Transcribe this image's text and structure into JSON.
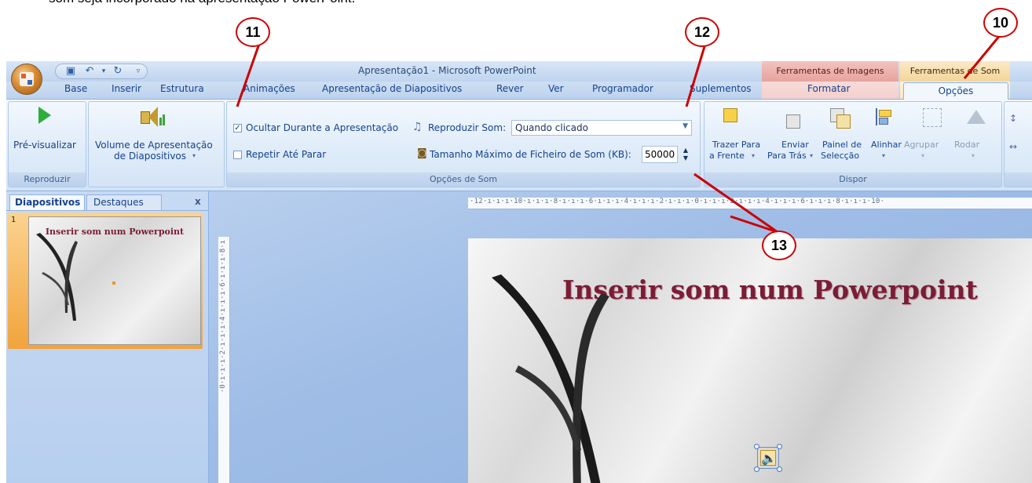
{
  "top_text": "som seja incorporado na apresentação PowerPoint.",
  "window": {
    "title": "Apresentação1 - Microsoft PowerPoint",
    "context_tabs": {
      "imagens": "Ferramentas de Imagens",
      "som": "Ferramentas de Som"
    }
  },
  "qat": {
    "save_icon": "save-icon",
    "undo_icon": "undo-icon",
    "redo_icon": "redo-icon",
    "customize_icon": "customize-icon"
  },
  "tabs": [
    "Base",
    "Inserir",
    "Estrutura",
    "Animações",
    "Apresentação de Diapositivos",
    "Rever",
    "Ver",
    "Programador",
    "Suplementos",
    "Formatar",
    "Opções"
  ],
  "ribbon": {
    "reproduzir": {
      "preview_label": "Pré-visualizar",
      "group_label": "Reproduzir"
    },
    "volume": {
      "label_line1": "Volume de Apresentação",
      "label_line2": "de Diapositivos"
    },
    "opcoes_som": {
      "hide_label": "Ocultar Durante a Apresentação",
      "hide_checked": true,
      "loop_label": "Repetir Até Parar",
      "loop_checked": false,
      "play_label": "Reproduzir Som:",
      "play_value": "Quando clicado",
      "maxsize_label": "Tamanho Máximo de Ficheiro de Som (KB):",
      "maxsize_value": "50000",
      "group_label": "Opções de Som"
    },
    "dispor": {
      "bring_front_line1": "Trazer Para",
      "bring_front_line2": "a Frente",
      "send_back_line1": "Enviar",
      "send_back_line2": "Para Trás",
      "selection_line1": "Painel de",
      "selection_line2": "Selecção",
      "align": "Alinhar",
      "group": "Agrupar",
      "rotate": "Rodar",
      "group_label": "Dispor"
    }
  },
  "left_pane": {
    "tab_slides": "Diapositivos",
    "tab_outline": "Destaques",
    "close": "x",
    "thumb_number": "1",
    "thumb_title": "Inserir som num Powerpoint"
  },
  "slide": {
    "title": "Inserir som num Powerpoint"
  },
  "rulers": {
    "horizontal": "·12·ı·ı·ı·10·ı·ı·ı·8·ı·ı·ı·6·ı·ı·ı·4·ı·ı·ı·2·ı·ı·ı·0·ı·ı·ı·2·ı·ı·ı·4·ı·ı·ı·6·ı·ı·ı·8·ı·ı·ı·10·",
    "vertical": "·0·ı·ı·ı·2·ı·ı·ı·4·ı·ı·ı·6·ı·ı·ı·8·ı"
  },
  "annotations": [
    "10",
    "11",
    "12",
    "13"
  ],
  "colors": {
    "annotation": "#cc0000",
    "title_text": "#7a1d35",
    "ribbon_text": "#15428b"
  }
}
